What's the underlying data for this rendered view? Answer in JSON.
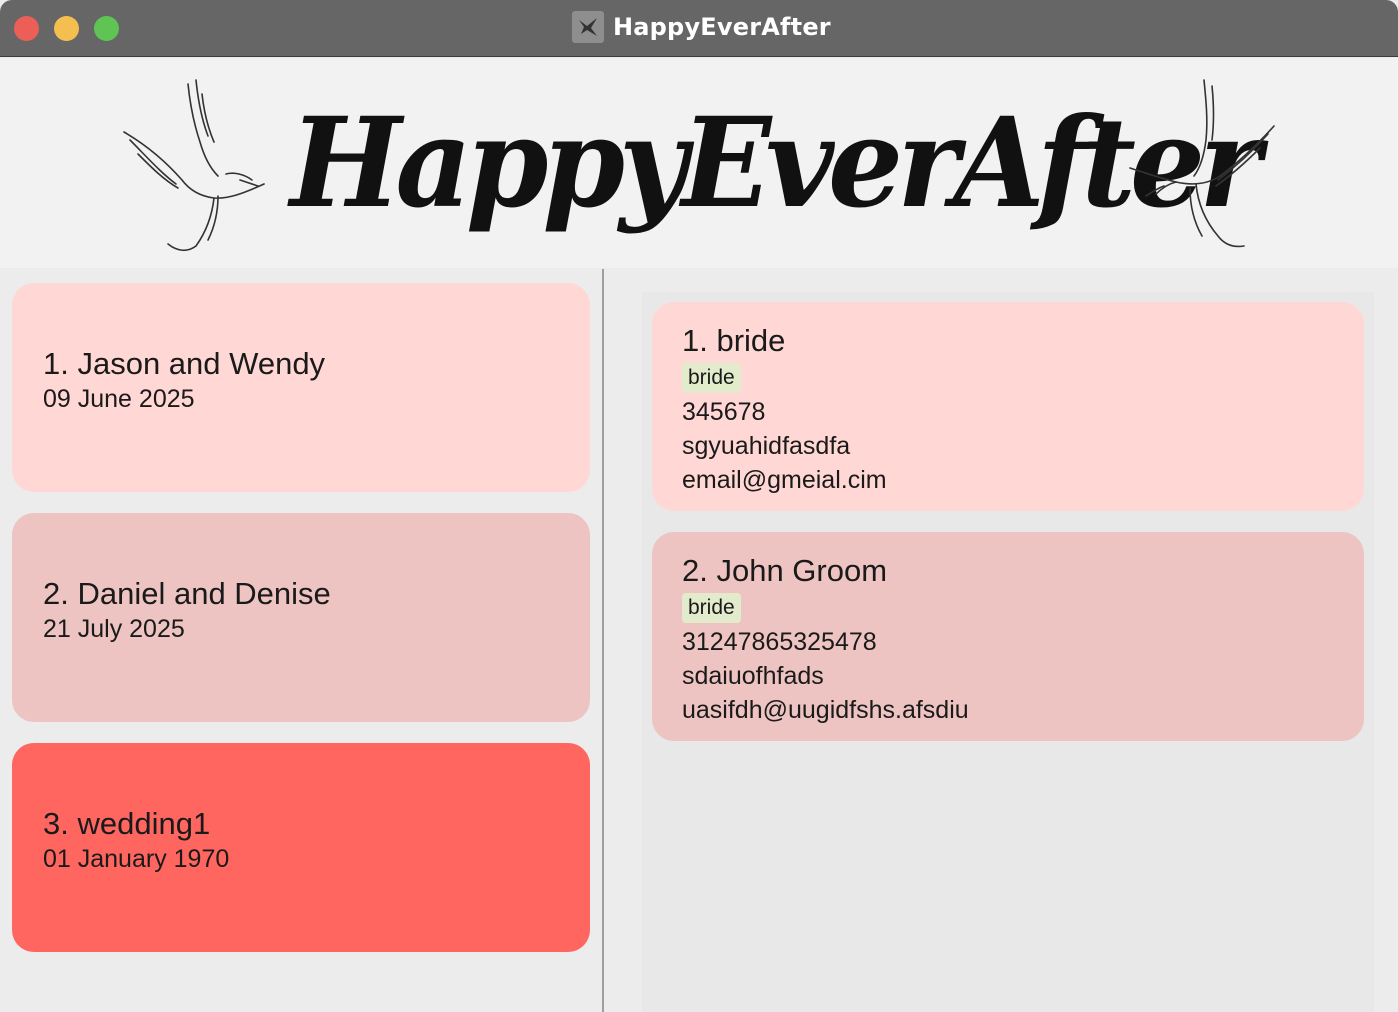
{
  "window": {
    "title": "HappyEverAfter"
  },
  "banner": {
    "logo_text": "HappyEverAfter"
  },
  "weddings": [
    {
      "title": "1. Jason and Wendy",
      "date": "09 June 2025",
      "color": "#ffd8d6"
    },
    {
      "title": "2. Daniel and Denise",
      "date": "21 July 2025",
      "color": "#edc4c2"
    },
    {
      "title": "3. wedding1",
      "date": "01 January 1970",
      "color": "#ff6660"
    }
  ],
  "persons": [
    {
      "name": "1. bride",
      "tag": "bride",
      "phone": "345678",
      "address": "sgyuahidfasdfa",
      "email": "email@gmeial.cim",
      "color": "#ffd8d6"
    },
    {
      "name": "2. John Groom",
      "tag": "bride",
      "phone": "31247865325478",
      "address": "sdaiuofhfads",
      "email": "uasifdh@uugidfshs.afsdiu",
      "color": "#edc4c2"
    }
  ],
  "colors": {
    "titlebar": "#666666",
    "tag_bg": "#e3ebcd"
  }
}
